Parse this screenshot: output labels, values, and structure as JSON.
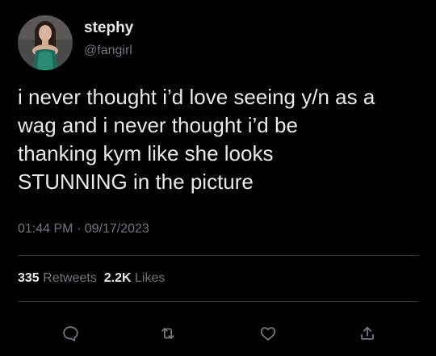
{
  "user": {
    "display_name": "stephy",
    "handle": "@fangirl"
  },
  "tweet": {
    "lines": [
      "i never thought i’d love seeing y/n as a",
      "wag and i never thought i’d be",
      "thanking kym like she looks",
      "STUNNING in the picture"
    ],
    "time": "01:44 PM",
    "separator": "·",
    "date": "09/17/2023"
  },
  "stats": {
    "retweets_count": "335",
    "retweets_label": "Retweets",
    "likes_count": "2.2K",
    "likes_label": "Likes"
  },
  "actions": {
    "reply_icon": "reply-icon",
    "retweet_icon": "retweet-icon",
    "like_icon": "heart-icon",
    "share_icon": "share-icon"
  },
  "colors": {
    "background": "#000000",
    "primary_text": "#e7e9ea",
    "secondary_text": "#71767b",
    "divider": "#2f3336"
  }
}
